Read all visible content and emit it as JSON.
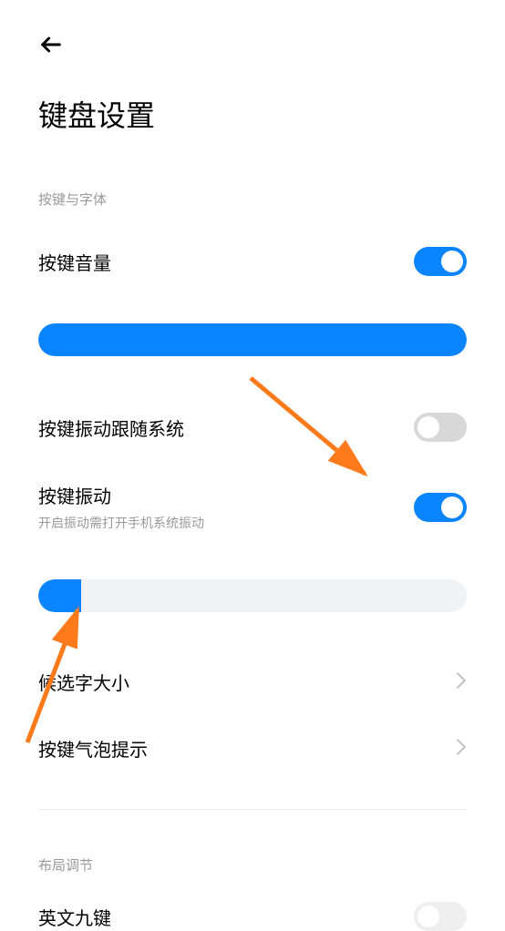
{
  "header": {
    "title": "键盘设置"
  },
  "sections": {
    "keys_font": {
      "label": "按键与字体",
      "sound": {
        "title": "按键音量",
        "on": true,
        "slider_value": 100
      },
      "vibration_system": {
        "title": "按键振动跟随系统",
        "on": false
      },
      "vibration": {
        "title": "按键振动",
        "subtitle": "开启振动需打开手机系统振动",
        "on": true,
        "slider_value": 10
      },
      "candidate_size": {
        "title": "候选字大小"
      },
      "bubble_hint": {
        "title": "按键气泡提示"
      }
    },
    "layout": {
      "label": "布局调节",
      "english_nine": {
        "title": "英文九键"
      }
    }
  },
  "colors": {
    "accent": "#0a84ff"
  }
}
